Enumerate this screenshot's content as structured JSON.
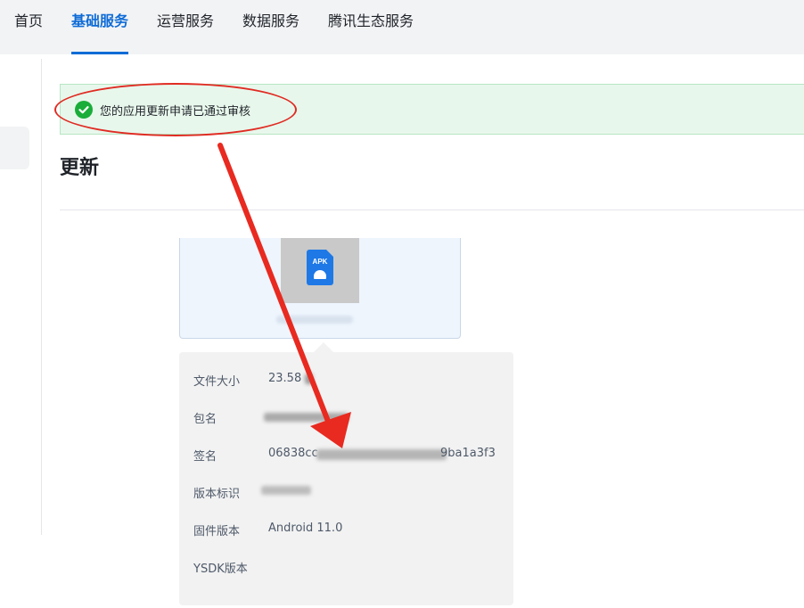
{
  "nav": {
    "items": [
      {
        "label": "首页",
        "active": false
      },
      {
        "label": "基础服务",
        "active": true
      },
      {
        "label": "运营服务",
        "active": false
      },
      {
        "label": "数据服务",
        "active": false
      },
      {
        "label": "腾讯生态服务",
        "active": false
      }
    ]
  },
  "alert": {
    "text": "您的应用更新申请已通过审核",
    "icon": "check-circle-icon",
    "color": "#1aad3a"
  },
  "page": {
    "title": "更新"
  },
  "file_card": {
    "icon_label": "APK",
    "icon": "android-apk-icon"
  },
  "info": {
    "rows": [
      {
        "label": "文件大小",
        "value": "23.58"
      },
      {
        "label": "包名",
        "value": ""
      },
      {
        "label": "签名",
        "value_prefix": "06838cc",
        "value_suffix": "9ba1a3f3"
      },
      {
        "label": "版本标识",
        "value": ""
      },
      {
        "label": "固件版本",
        "value": "Android 11.0"
      },
      {
        "label": "YSDK版本",
        "value": ""
      }
    ]
  },
  "colors": {
    "accent": "#0f6cd6",
    "annotation": "#e02b22",
    "success": "#1aad3a"
  }
}
